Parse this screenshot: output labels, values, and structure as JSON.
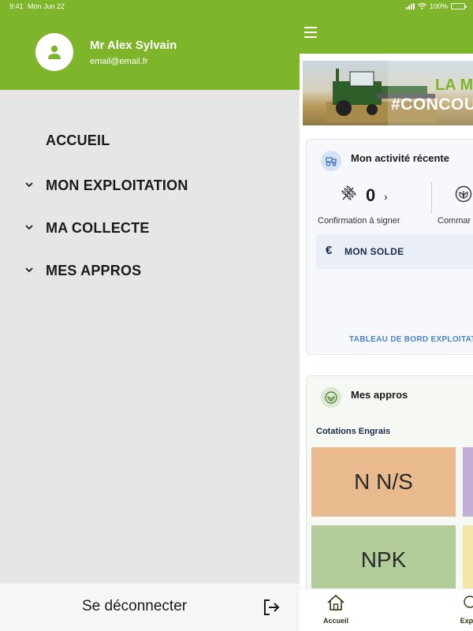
{
  "status_bar": {
    "time": "9:41",
    "date": "Mon Jun 22",
    "battery": "100%"
  },
  "drawer": {
    "user": {
      "name": "Mr Alex Sylvain",
      "email": "email@email.fr"
    },
    "items": [
      {
        "label": "ACCUEIL",
        "expandable": false
      },
      {
        "label": "MON EXPLOITATION",
        "expandable": true
      },
      {
        "label": "MA COLLECTE",
        "expandable": true
      },
      {
        "label": "MES APPROS",
        "expandable": true
      }
    ],
    "logout_label": "Se déconnecter"
  },
  "banner": {
    "line1": "LA M",
    "line2": "#CONCOU"
  },
  "activity_card": {
    "title": "Mon activité récente",
    "stats": [
      {
        "count": "0",
        "label": "Confirmation à signer"
      },
      {
        "label": "Commar"
      }
    ],
    "solde_symbol": "€",
    "solde_label": "MON SOLDE",
    "dashboard_link": "TABLEAU DE BORD EXPLOITAT"
  },
  "appros_card": {
    "title": "Mes appros",
    "subtitle": "Cotations Engrais",
    "tiles": [
      "N N/S",
      "NPK"
    ]
  },
  "bottom_nav": {
    "items": [
      {
        "label": "Accueil"
      },
      {
        "label": "Explo"
      }
    ]
  },
  "colors": {
    "brand_green": "#7fb52b",
    "drawer_bg": "#e6e6e6",
    "tile_nns": "#e8ba8e",
    "tile_npk": "#b2cd99"
  }
}
